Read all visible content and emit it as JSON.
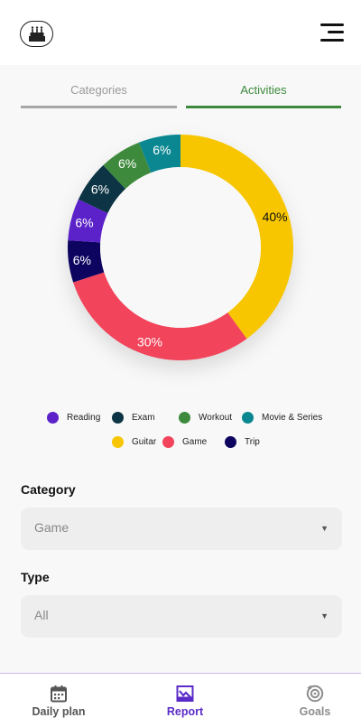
{
  "header": {
    "logo_icon": "birthday-cake-icon",
    "menu_icon": "menu-icon"
  },
  "tabs": [
    {
      "label": "Categories",
      "active": false
    },
    {
      "label": "Activities",
      "active": true
    }
  ],
  "colors": {
    "accent_green": "#3e8a3c",
    "brand_purple": "#5b2bc9",
    "inactive_gray": "#a6a6a6"
  },
  "chart_data": {
    "type": "pie",
    "style": "donut",
    "slices": [
      {
        "label": "Guitar",
        "value": 40,
        "display": "40%",
        "color": "#f7c600",
        "label_color": "#111111"
      },
      {
        "label": "Game",
        "value": 30,
        "display": "30%",
        "color": "#f2445b",
        "label_color": "#ffffff"
      },
      {
        "label": "Trip",
        "value": 6,
        "display": "6%",
        "color": "#0d0460",
        "label_color": "#ffffff"
      },
      {
        "label": "Reading",
        "value": 6,
        "display": "6%",
        "color": "#5b22c9",
        "label_color": "#ffffff"
      },
      {
        "label": "Exam",
        "value": 6,
        "display": "6%",
        "color": "#0d3444",
        "label_color": "#ffffff"
      },
      {
        "label": "Workout",
        "value": 6,
        "display": "6%",
        "color": "#3e8a3c",
        "label_color": "#ffffff"
      },
      {
        "label": "Movie & Series",
        "value": 6,
        "display": "6%",
        "color": "#0a8790",
        "label_color": "#ffffff"
      }
    ],
    "legend_placement": "bottom"
  },
  "legend": [
    {
      "label": "Reading",
      "color": "#5b22c9"
    },
    {
      "label": "Exam",
      "color": "#0d3444"
    },
    {
      "label": "Workout",
      "color": "#3e8a3c"
    },
    {
      "label": "Movie & Series",
      "color": "#0a8790"
    },
    {
      "label": "Guitar",
      "color": "#f7c600"
    },
    {
      "label": "Game",
      "color": "#f2445b"
    },
    {
      "label": "Trip",
      "color": "#0d0460"
    }
  ],
  "form": {
    "category": {
      "label": "Category",
      "value": "Game"
    },
    "type": {
      "label": "Type",
      "value": "All"
    },
    "caret": "▼"
  },
  "nav": [
    {
      "label": "Daily plan",
      "icon": "calendar-icon",
      "active": false,
      "color": "#555555"
    },
    {
      "label": "Report",
      "icon": "chart-icon",
      "active": true,
      "color": "#5b2bc9"
    },
    {
      "label": "Goals",
      "icon": "goals-target-icon",
      "active": false,
      "color": "#8d8d8d"
    }
  ]
}
